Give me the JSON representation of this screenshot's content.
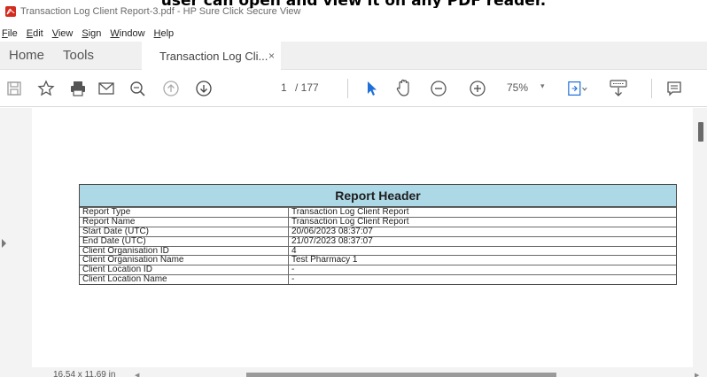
{
  "caption": "user can open and view it on any PDF reader.",
  "window": {
    "title": "Transaction Log Client Report-3.pdf - HP Sure Click Secure View"
  },
  "menu": [
    {
      "mnemonic": "F",
      "rest": "ile"
    },
    {
      "mnemonic": "E",
      "rest": "dit"
    },
    {
      "mnemonic": "V",
      "rest": "iew"
    },
    {
      "mnemonic": "S",
      "rest": "ign"
    },
    {
      "mnemonic": "W",
      "rest": "indow"
    },
    {
      "mnemonic": "H",
      "rest": "elp"
    }
  ],
  "tabs": {
    "home": "Home",
    "tools": "Tools",
    "document": "Transaction Log Cli...",
    "close": "×"
  },
  "toolbar": {
    "page_current": "1",
    "page_total": "/ 177",
    "zoom": "75%",
    "zoom_caret": "▾"
  },
  "report": {
    "header": "Report Header",
    "rows": [
      {
        "key": "Report Type",
        "value": "Transaction Log Client Report"
      },
      {
        "key": "Report Name",
        "value": "Transaction Log Client Report"
      },
      {
        "key": "Start Date (UTC)",
        "value": "20/06/2023 08:37:07"
      },
      {
        "key": "End Date (UTC)",
        "value": "21/07/2023 08:37:07"
      },
      {
        "key": "Client Organisation ID",
        "value": "4"
      },
      {
        "key": "Client Organisation Name",
        "value": "Test Pharmacy 1"
      },
      {
        "key": "Client Location ID",
        "value": "-"
      },
      {
        "key": "Client Location Name",
        "value": "-"
      }
    ]
  },
  "status": {
    "page_size": "16.54 x 11.69 in",
    "scroll_left": "◀",
    "scroll_right": "▶"
  },
  "colors": {
    "report_header_bg": "#add8e6",
    "brand_red": "#d42b1e",
    "select_cursor": "#1e6fd9"
  }
}
